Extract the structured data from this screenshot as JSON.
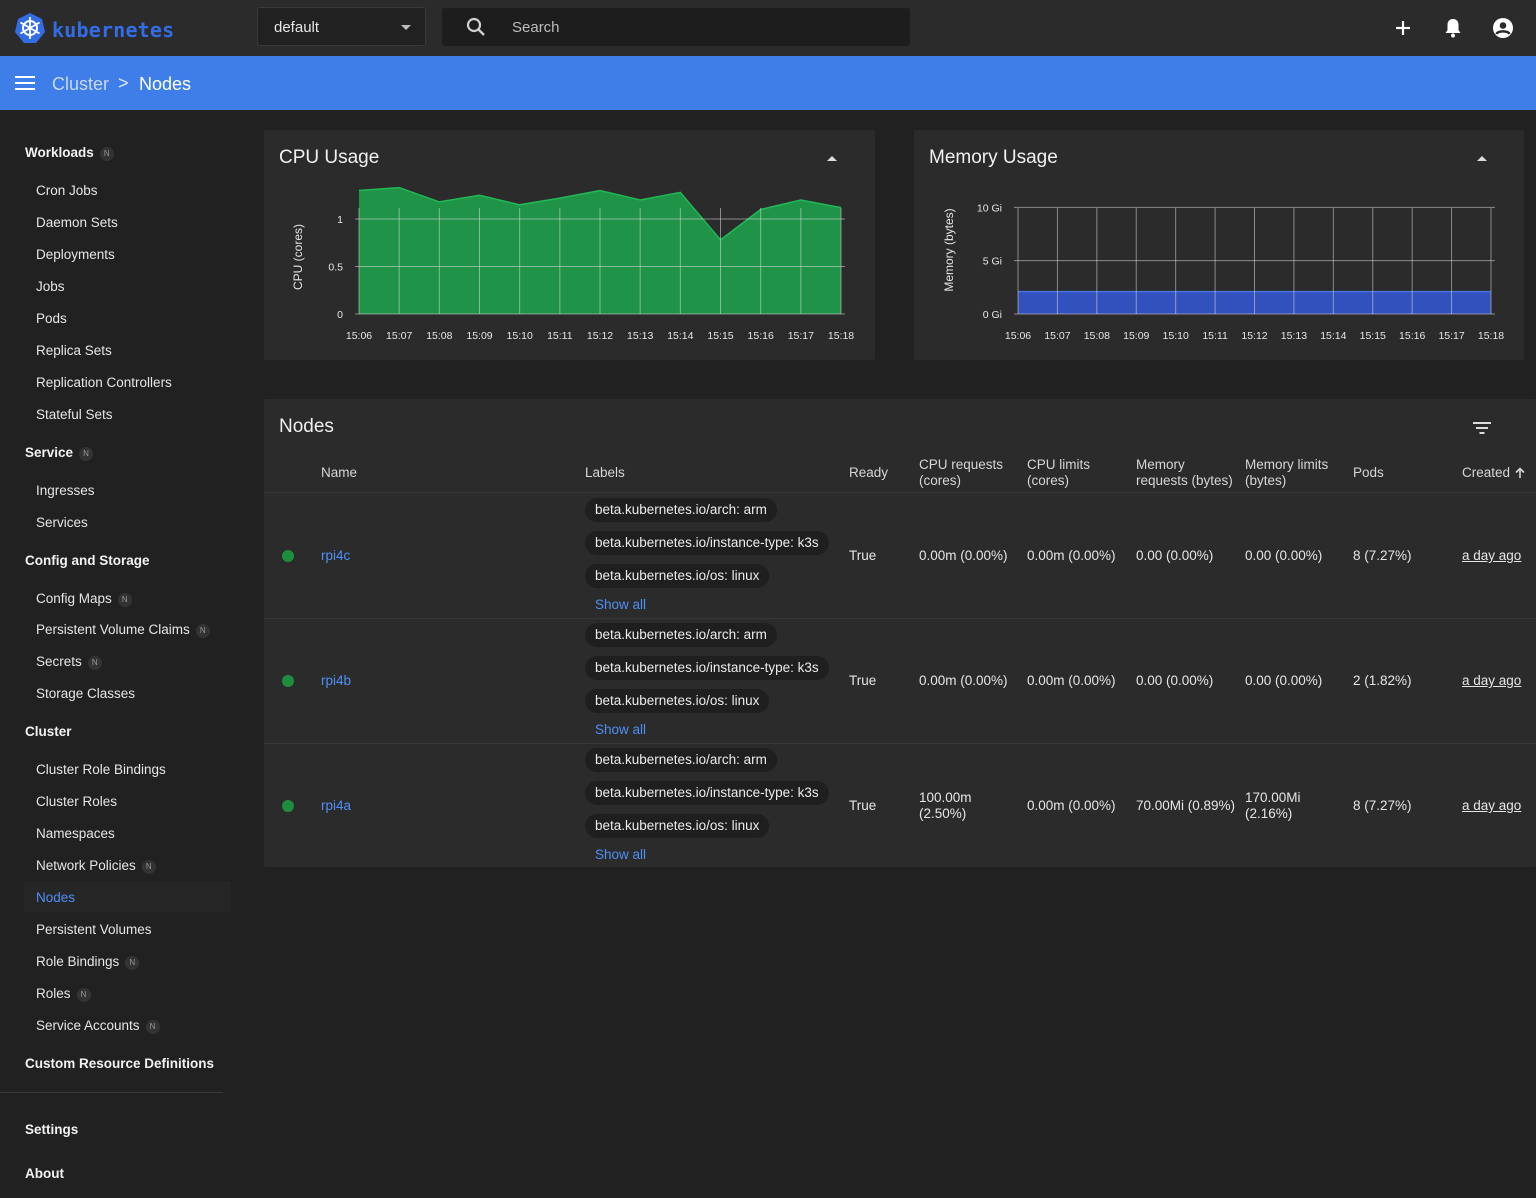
{
  "app": {
    "name": "kubernetes"
  },
  "namespace": {
    "selected": "default"
  },
  "search": {
    "placeholder": "Search"
  },
  "breadcrumb": {
    "parent": "Cluster",
    "separator": ">",
    "current": "Nodes"
  },
  "icons": {
    "logo": "kubernetes-wheel-icon",
    "search": "search-icon",
    "create": "plus-icon",
    "notifications": "bell-icon",
    "account": "account-circle-icon",
    "menu": "hamburger-menu-icon",
    "filter": "filter-icon",
    "sort": "arrow-up-icon"
  },
  "colors": {
    "accent": "#3f7ee8",
    "link": "#4f8ff7",
    "cpu_fill": "#1e9e4a",
    "memory_fill": "#3355cc",
    "ready": "#1e8e3e"
  },
  "sidebar": {
    "badge": "N",
    "workloads": {
      "label": "Workloads",
      "items": [
        "Cron Jobs",
        "Daemon Sets",
        "Deployments",
        "Jobs",
        "Pods",
        "Replica Sets",
        "Replication Controllers",
        "Stateful Sets"
      ]
    },
    "service": {
      "label": "Service",
      "items": [
        "Ingresses",
        "Services"
      ]
    },
    "config": {
      "label": "Config and Storage",
      "items": [
        "Config Maps",
        "Persistent Volume Claims",
        "Secrets",
        "Storage Classes"
      ]
    },
    "cluster": {
      "label": "Cluster",
      "items": [
        "Cluster Role Bindings",
        "Cluster Roles",
        "Namespaces",
        "Network Policies",
        "Nodes",
        "Persistent Volumes",
        "Role Bindings",
        "Roles",
        "Service Accounts"
      ]
    },
    "crd": "Custom Resource Definitions",
    "settings": "Settings",
    "about": "About"
  },
  "cpu_card": {
    "title": "CPU Usage"
  },
  "memory_card": {
    "title": "Memory Usage"
  },
  "chart_data": [
    {
      "type": "area",
      "title": "CPU Usage",
      "ylabel": "CPU (cores)",
      "xlabel": "",
      "ylim": [
        0,
        1.2
      ],
      "yticks": [
        "0",
        "0.5",
        "1"
      ],
      "x": [
        "15:06",
        "15:07",
        "15:08",
        "15:09",
        "15:10",
        "15:11",
        "15:12",
        "15:13",
        "15:14",
        "15:15",
        "15:16",
        "15:17",
        "15:18"
      ],
      "series": [
        {
          "values": [
            1.3,
            1.33,
            1.18,
            1.25,
            1.15,
            1.22,
            1.3,
            1.2,
            1.28,
            0.78,
            1.1,
            1.2,
            1.12
          ]
        }
      ],
      "grid": true
    },
    {
      "type": "area",
      "title": "Memory Usage",
      "ylabel": "Memory (bytes)",
      "xlabel": "",
      "ylim": [
        0,
        12
      ],
      "yticks": [
        "0 Gi",
        "5 Gi",
        "10 Gi"
      ],
      "x": [
        "15:06",
        "15:07",
        "15:08",
        "15:09",
        "15:10",
        "15:11",
        "15:12",
        "15:13",
        "15:14",
        "15:15",
        "15:16",
        "15:17",
        "15:18"
      ],
      "series": [
        {
          "values": [
            2.1,
            2.1,
            2.1,
            2.1,
            2.1,
            2.1,
            2.1,
            2.1,
            2.1,
            2.1,
            2.1,
            2.1,
            2.1
          ]
        }
      ],
      "grid": true
    }
  ],
  "nodes_card": {
    "title": "Nodes",
    "columns": {
      "name": "Name",
      "labels": "Labels",
      "ready": "Ready",
      "cpu_requests": "CPU requests (cores)",
      "cpu_limits": "CPU limits (cores)",
      "mem_requests": "Memory requests (bytes)",
      "mem_limits": "Memory limits (bytes)",
      "pods": "Pods",
      "created": "Created"
    },
    "show_all": "Show all",
    "rows": [
      {
        "name": "rpi4c",
        "labels": [
          "beta.kubernetes.io/arch: arm",
          "beta.kubernetes.io/instance-type: k3s",
          "beta.kubernetes.io/os: linux"
        ],
        "ready": "True",
        "cpu_requests": "0.00m (0.00%)",
        "cpu_limits": "0.00m (0.00%)",
        "mem_requests": "0.00 (0.00%)",
        "mem_limits": "0.00 (0.00%)",
        "pods": "8 (7.27%)",
        "created": "a day ago"
      },
      {
        "name": "rpi4b",
        "labels": [
          "beta.kubernetes.io/arch: arm",
          "beta.kubernetes.io/instance-type: k3s",
          "beta.kubernetes.io/os: linux"
        ],
        "ready": "True",
        "cpu_requests": "0.00m (0.00%)",
        "cpu_limits": "0.00m (0.00%)",
        "mem_requests": "0.00 (0.00%)",
        "mem_limits": "0.00 (0.00%)",
        "pods": "2 (1.82%)",
        "created": "a day ago"
      },
      {
        "name": "rpi4a",
        "labels": [
          "beta.kubernetes.io/arch: arm",
          "beta.kubernetes.io/instance-type: k3s",
          "beta.kubernetes.io/os: linux"
        ],
        "ready": "True",
        "cpu_requests": "100.00m (2.50%)",
        "cpu_limits": "0.00m (0.00%)",
        "mem_requests": "70.00Mi (0.89%)",
        "mem_limits": "170.00Mi (2.16%)",
        "pods": "8 (7.27%)",
        "created": "a day ago"
      }
    ]
  }
}
